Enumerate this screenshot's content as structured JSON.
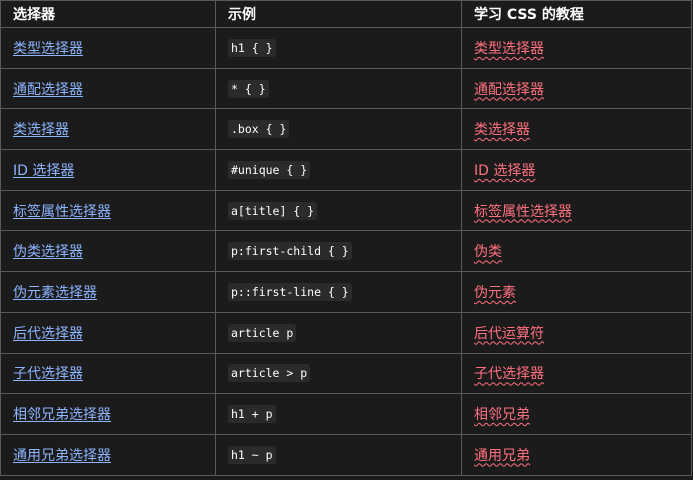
{
  "table": {
    "headers": [
      "选择器",
      "示例",
      "学习 CSS 的教程"
    ],
    "rows": [
      {
        "selector": "类型选择器",
        "example": "h1 { }",
        "tutorial": "类型选择器"
      },
      {
        "selector": "通配选择器",
        "example": "* { }",
        "tutorial": "通配选择器"
      },
      {
        "selector": "类选择器",
        "example": ".box { }",
        "tutorial": "类选择器"
      },
      {
        "selector": "ID 选择器",
        "example": "#unique { }",
        "tutorial": "ID 选择器"
      },
      {
        "selector": "标签属性选择器",
        "example": "a[title] { }",
        "tutorial": "标签属性选择器"
      },
      {
        "selector": "伪类选择器",
        "example": "p:first-child { }",
        "tutorial": "伪类"
      },
      {
        "selector": "伪元素选择器",
        "example": "p::first-line { }",
        "tutorial": "伪元素"
      },
      {
        "selector": "后代选择器",
        "example": "article p",
        "tutorial": "后代运算符"
      },
      {
        "selector": "子代选择器",
        "example": "article > p",
        "tutorial": "子代选择器"
      },
      {
        "selector": "相邻兄弟选择器",
        "example": "h1 + p",
        "tutorial": "相邻兄弟"
      },
      {
        "selector": "通用兄弟选择器",
        "example": "h1 ~ p",
        "tutorial": "通用兄弟"
      }
    ]
  },
  "colors": {
    "background": "#1b1b1b",
    "border": "#5a5a5a",
    "link": "#8cb4ff",
    "broken_link": "#ff707f",
    "code_background": "#2b2b2b"
  }
}
